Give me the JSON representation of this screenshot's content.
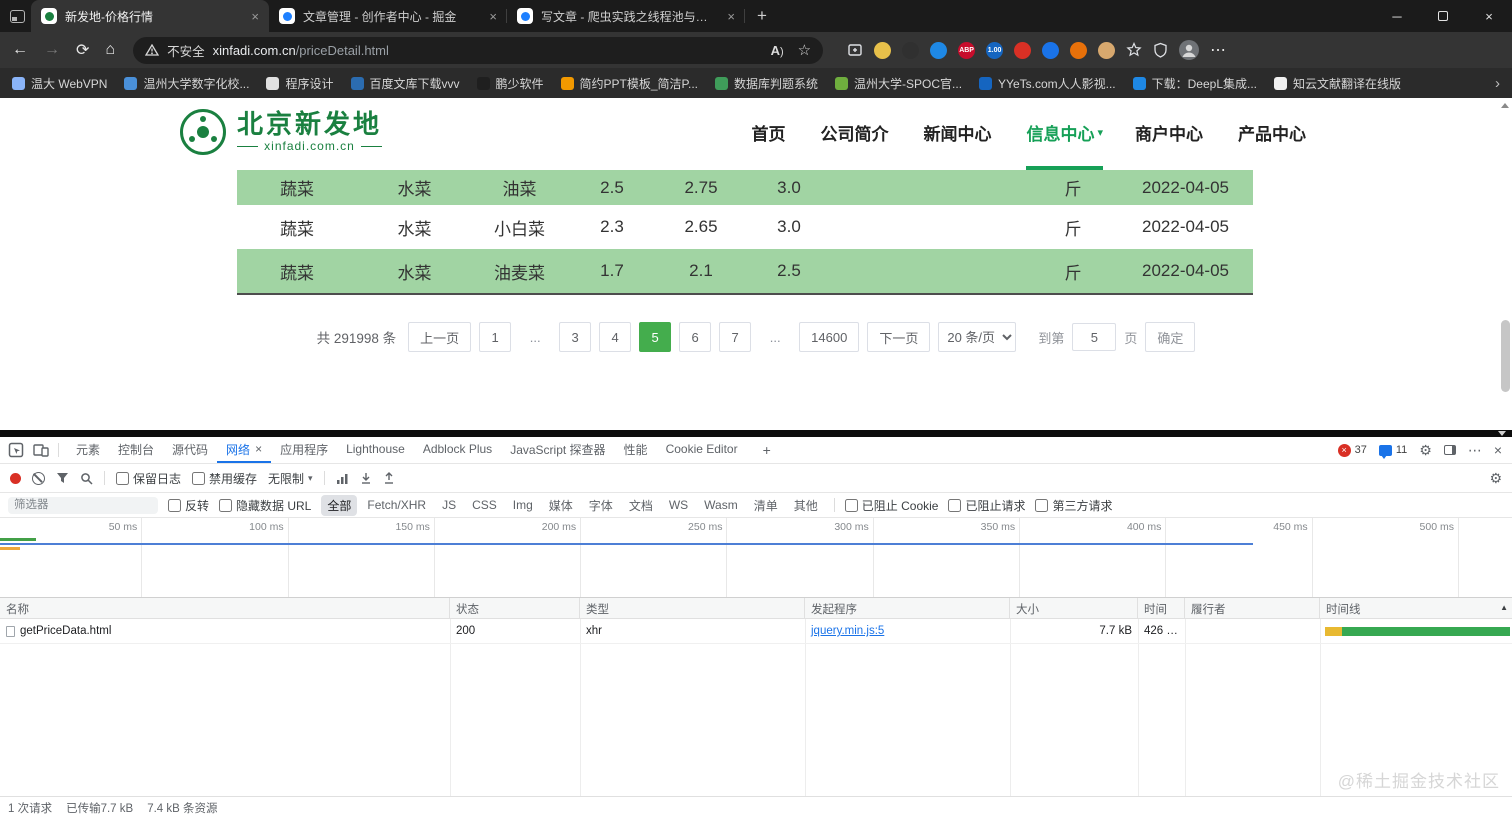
{
  "colors": {
    "brand_green": "#1a8040",
    "accent_green": "#44ad4d",
    "row_green": "#a1d4a3",
    "devtools_blue": "#1a73e8",
    "error_red": "#d93025",
    "waterfall_orange": "#e8b931",
    "waterfall_green": "#36a851"
  },
  "browser": {
    "tabs": [
      {
        "title": "新发地-价格行情",
        "active": true,
        "fav_bg": "#ffffff",
        "fav_dot": "#1a8040"
      },
      {
        "title": "文章管理 - 创作者中心 - 掘金",
        "fav_bg": "#ffffff",
        "fav_dot": "#1e80ff"
      },
      {
        "title": "写文章 - 爬虫实践之线程池与多线",
        "fav_bg": "#ffffff",
        "fav_dot": "#1e80ff"
      }
    ],
    "new_tab": "+",
    "window_controls": {
      "minimize": "─",
      "close": "×"
    },
    "nav_icons": {
      "back": "←",
      "forward": "→",
      "refresh": "⟳",
      "home": "⌂"
    },
    "address": {
      "security_label": "不安全",
      "host": "xinfadi.com.cn",
      "path": "/priceDetail.html"
    },
    "pill": {
      "read_aloud": "A",
      "favorite": "☆"
    },
    "extensions": [
      {
        "name": "extension-yellow",
        "color": "#e7c04a",
        "label": ""
      },
      {
        "name": "extension-black",
        "color": "#303030",
        "label": ""
      },
      {
        "name": "extension-blue",
        "color": "#1e88e5",
        "label": ""
      },
      {
        "name": "adblock-plus",
        "color": "#c70d2c",
        "label": "ABP"
      },
      {
        "name": "price-tag",
        "color": "#1565c0",
        "label": "1.00"
      },
      {
        "name": "extension-red",
        "color": "#d93025",
        "label": ""
      },
      {
        "name": "extension-dot-blue",
        "color": "#1a73e8",
        "label": ""
      },
      {
        "name": "extension-orange",
        "color": "#e8710a",
        "label": ""
      },
      {
        "name": "cookie-manager",
        "color": "#d7a86e",
        "label": ""
      }
    ],
    "bookmarks": [
      {
        "label": "温大 WebVPN",
        "color": "#8ab4f8"
      },
      {
        "label": "温州大学数字化校...",
        "color": "#4a90d9"
      },
      {
        "label": "程序设计",
        "color": "#e0e0e0"
      },
      {
        "label": "百度文库下载vvv",
        "color": "#2b6cb0"
      },
      {
        "label": "鹏少软件",
        "color": "#1f1f1f"
      },
      {
        "label": "简约PPT模板_简洁P...",
        "color": "#f29900"
      },
      {
        "label": "数据库判题系统",
        "color": "#3f9c5a"
      },
      {
        "label": "温州大学-SPOC官...",
        "color": "#6fae3e"
      },
      {
        "label": "YYeTs.com人人影视...",
        "color": "#1565c0"
      },
      {
        "label": "下载：DeepL集成...",
        "color": "#1e88e5"
      },
      {
        "label": "知云文献翻译在线版",
        "color": "#f0f0f0"
      }
    ],
    "bookmarks_overflow": "›"
  },
  "site": {
    "logo": {
      "title": "北京新发地",
      "domain": "xinfadi.com.cn"
    },
    "nav": [
      {
        "label": "首页"
      },
      {
        "label": "公司简介"
      },
      {
        "label": "新闻中心"
      },
      {
        "label": "信息中心",
        "active": true,
        "caret": "▾"
      },
      {
        "label": "商户中心"
      },
      {
        "label": "产品中心"
      }
    ],
    "price_table": {
      "rows": [
        {
          "class": "shade clip",
          "cells": [
            "蔬菜",
            "水菜",
            "油菜",
            "2.5",
            "2.75",
            "3.0",
            "",
            "斤",
            "2022-04-05"
          ]
        },
        {
          "class": "",
          "cells": [
            "蔬菜",
            "水菜",
            "小白菜",
            "2.3",
            "2.65",
            "3.0",
            "",
            "斤",
            "2022-04-05"
          ]
        },
        {
          "class": "shade",
          "cells": [
            "蔬菜",
            "水菜",
            "油麦菜",
            "1.7",
            "2.1",
            "2.5",
            "",
            "斤",
            "2022-04-05"
          ]
        }
      ]
    },
    "pagination": {
      "total": "共 291998 条",
      "prev": "上一页",
      "pages": [
        {
          "label": "1"
        },
        {
          "label": "...",
          "class": "ellipsis"
        },
        {
          "label": "3"
        },
        {
          "label": "4"
        },
        {
          "label": "5",
          "active": true
        },
        {
          "label": "6"
        },
        {
          "label": "7"
        },
        {
          "label": "...",
          "class": "ellipsis"
        },
        {
          "label": "14600"
        }
      ],
      "next": "下一页",
      "page_size": "20 条/页",
      "jump_label": "到第",
      "jump_value": "5",
      "jump_unit": "页",
      "confirm": "确定"
    }
  },
  "devtools": {
    "tabs": [
      {
        "label": "元素"
      },
      {
        "label": "控制台"
      },
      {
        "label": "源代码"
      },
      {
        "label": "网络",
        "active": true,
        "class": "with-close"
      },
      {
        "label": "应用程序"
      },
      {
        "label": "Lighthouse"
      },
      {
        "label": "Adblock Plus"
      },
      {
        "label": "JavaScript 探查器"
      },
      {
        "label": "性能"
      },
      {
        "label": "Cookie Editor"
      }
    ],
    "more_tabs": "+",
    "badges": {
      "errors": "37",
      "issues": "11"
    },
    "network_toolbar": {
      "preserve_log": "保留日志",
      "disable_cache": "禁用缓存",
      "throttling": "无限制",
      "throttle_caret": "▾"
    },
    "filter_bar": {
      "placeholder": "筛选器",
      "invert": "反转",
      "hide_data_urls": "隐藏数据 URL",
      "types": [
        {
          "label": "全部",
          "active": true
        },
        {
          "label": "Fetch/XHR"
        },
        {
          "label": "JS"
        },
        {
          "label": "CSS"
        },
        {
          "label": "Img"
        },
        {
          "label": "媒体"
        },
        {
          "label": "字体"
        },
        {
          "label": "文档"
        },
        {
          "label": "WS"
        },
        {
          "label": "Wasm"
        },
        {
          "label": "清单"
        },
        {
          "label": "其他"
        }
      ],
      "blocked_cookies": "已阻止 Cookie",
      "blocked_requests": "已阻止请求",
      "third_party": "第三方请求"
    },
    "overview_ticks": [
      "50 ms",
      "100 ms",
      "150 ms",
      "200 ms",
      "250 ms",
      "300 ms",
      "350 ms",
      "400 ms",
      "450 ms",
      "500 ms"
    ],
    "grid": {
      "headers": [
        "名称",
        "状态",
        "类型",
        "发起程序",
        "大小",
        "时间",
        "履行者",
        "时间线"
      ],
      "sort_icon": "▲",
      "rows": [
        {
          "name": "getPriceData.html",
          "status": "200",
          "type": "xhr",
          "initiator": "jquery.min.js:5",
          "size": "7.7 kB",
          "time": "426 …",
          "fulfilled_by": ""
        }
      ]
    },
    "summary": {
      "requests": "1 次请求",
      "transferred": "已传输7.7 kB",
      "resources": "7.4 kB 条资源"
    },
    "watermark": "@稀土掘金技术社区"
  }
}
